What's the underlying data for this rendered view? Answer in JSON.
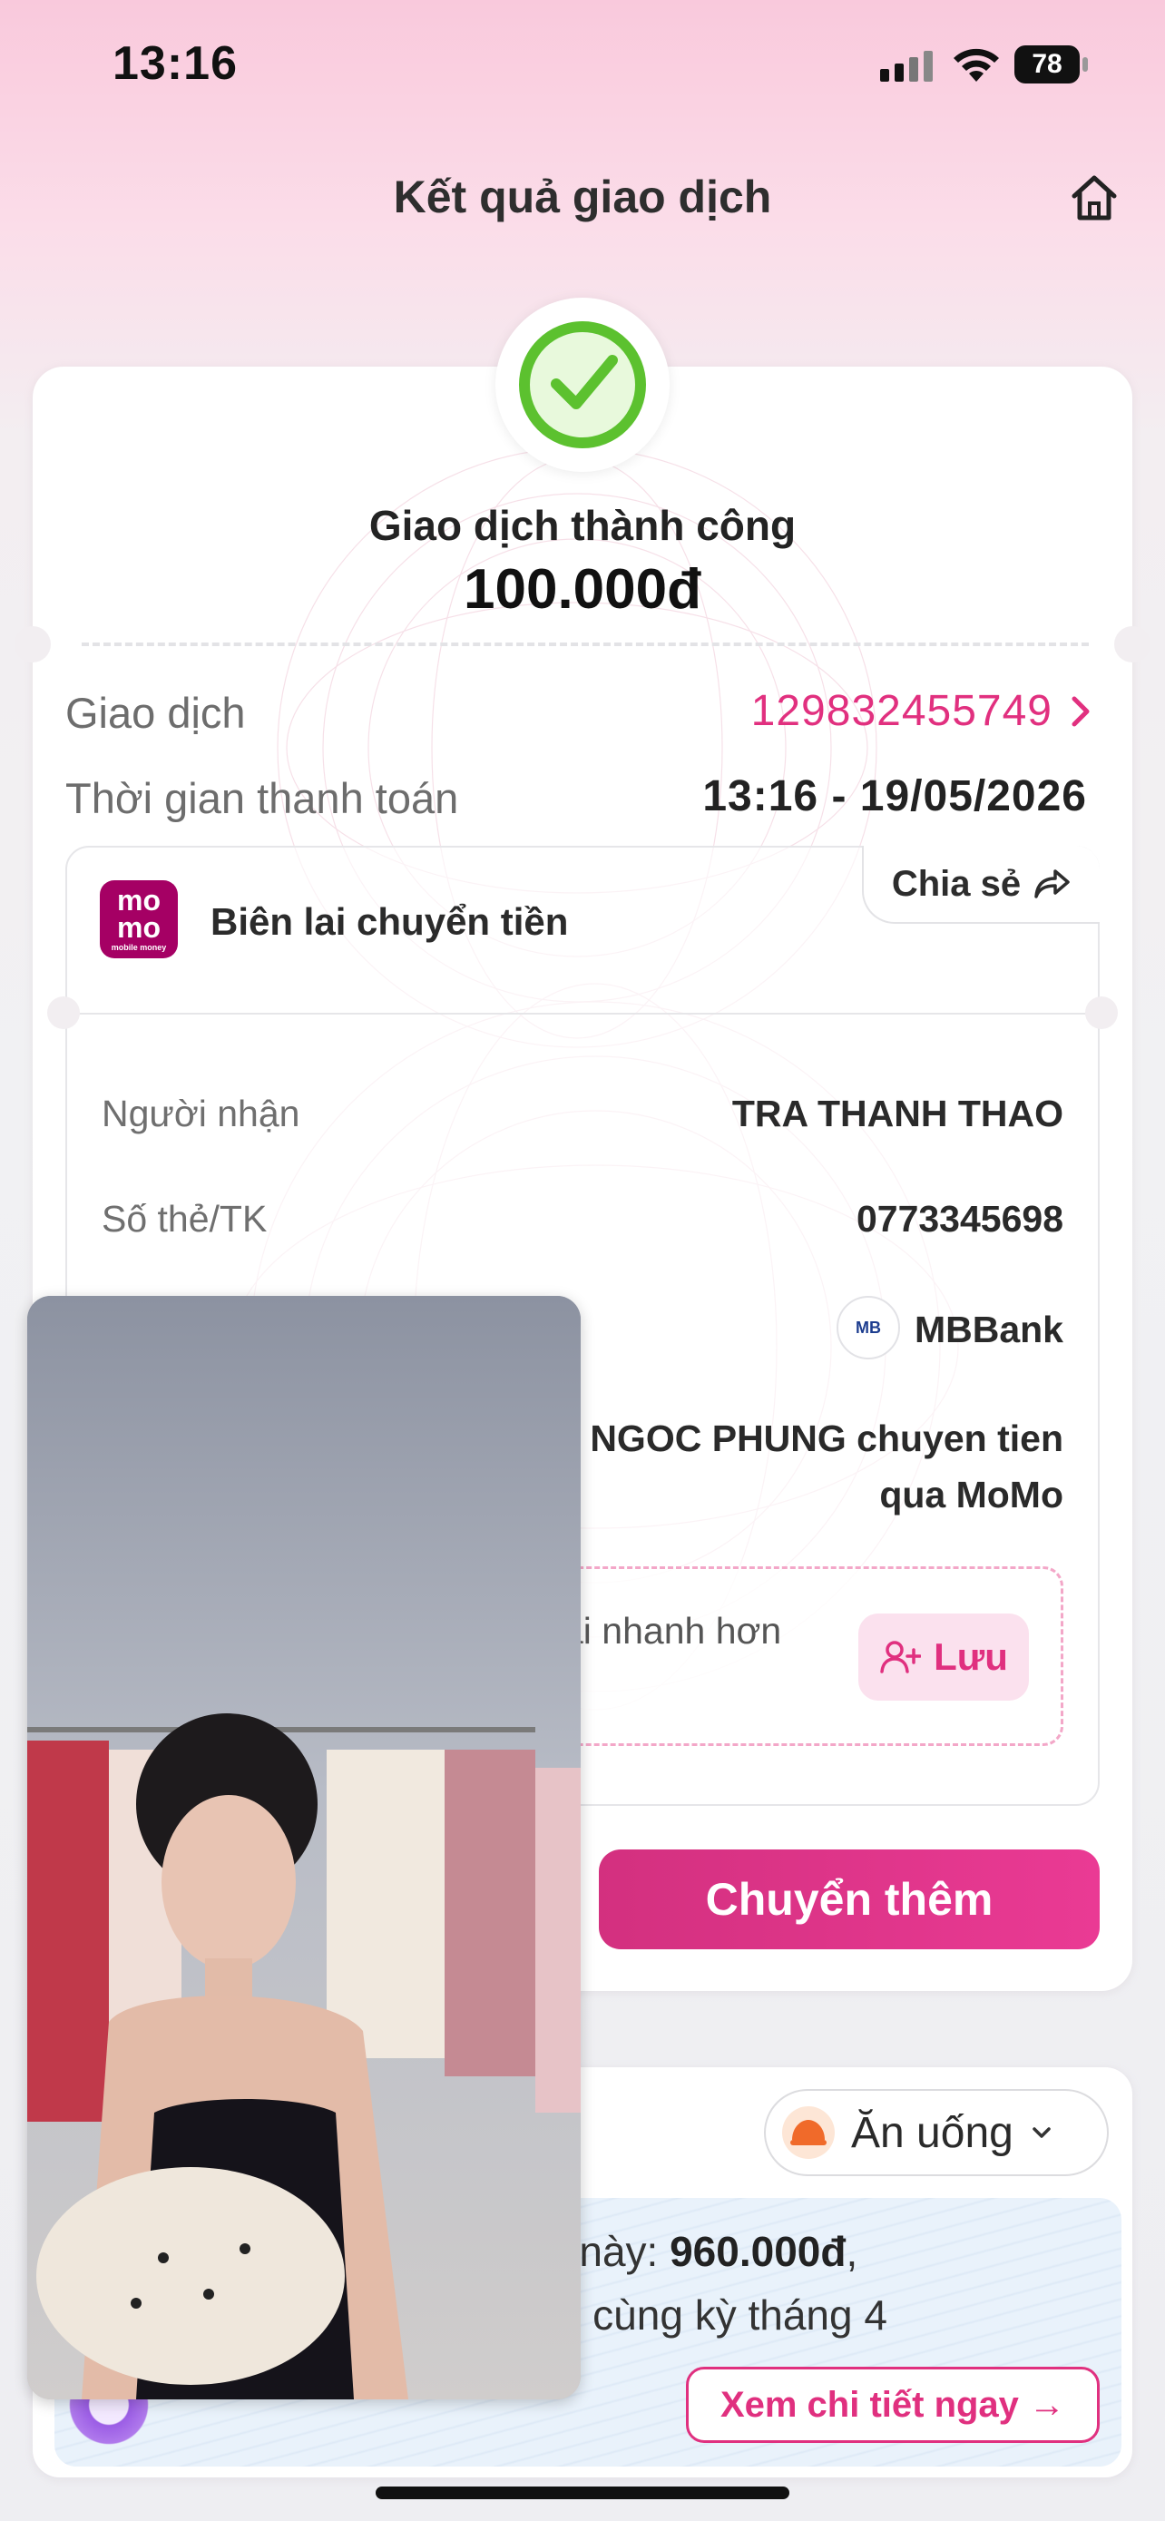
{
  "status_bar": {
    "time": "13:16",
    "battery": "78"
  },
  "header": {
    "title": "Kết quả giao dịch"
  },
  "result": {
    "status": "Giao dịch thành công",
    "amount": "100.000đ"
  },
  "transaction": {
    "id_label": "Giao dịch",
    "id_value": "129832455749",
    "time_label": "Thời gian thanh toán",
    "time_value": "13:16 - 19/05/2026"
  },
  "receipt": {
    "logo_line1": "mo",
    "logo_line2": "mo",
    "logo_caption": "mobile money",
    "title": "Biên lai chuyển tiền",
    "share_label": "Chia sẻ",
    "recipient_label": "Người nhận",
    "recipient_value": "TRA THANH THAO",
    "account_label": "Số thẻ/TK",
    "account_value": "0773345698",
    "bank_logo": "MB",
    "bank_value": "MBBank",
    "message_line1": "NGOC PHUNG chuyen tien",
    "message_line2": "qua MoMo",
    "save_partial": "ại nhanh hơn",
    "save_label": "Lưu"
  },
  "actions": {
    "transfer_more": "Chuyển thêm"
  },
  "insight": {
    "category": "Ăn uống",
    "line1_prefix": "g này: ",
    "line1_amount": "960.000đ",
    "line1_suffix": ",",
    "line2": "ới cùng kỳ tháng 4",
    "detail_button": "Xem chi tiết ngay →"
  },
  "colors": {
    "accent": "#e0307f",
    "success": "#5cc12f",
    "brand": "#a50064"
  }
}
